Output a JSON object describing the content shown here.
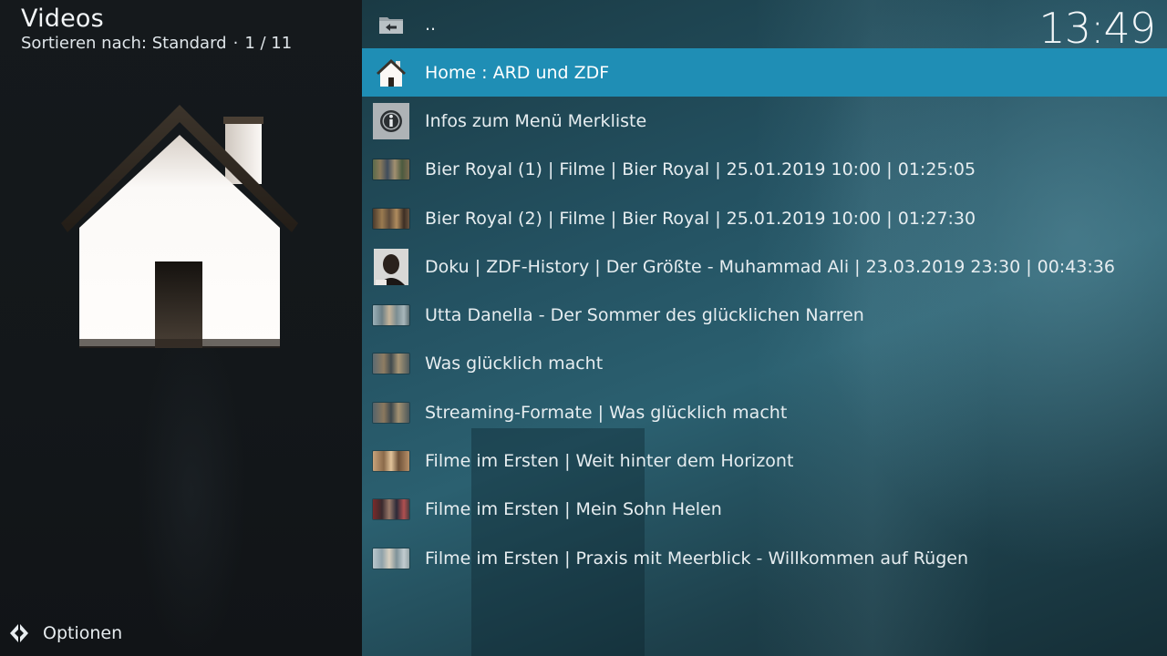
{
  "header": {
    "title": "Videos",
    "sort_label": "Sortieren nach: Standard",
    "separator": "·",
    "position": "1 / 11"
  },
  "clock": "13:49",
  "footer": {
    "options_label": "Optionen"
  },
  "list": {
    "parent_label": "..",
    "items": [
      {
        "label": "Home : ARD und ZDF",
        "icon": "home-icon",
        "focused": true
      },
      {
        "label": "Infos zum Menü Merkliste",
        "icon": "info-icon"
      },
      {
        "label": "Bier Royal (1) | Filme | Bier Royal | 25.01.2019 10:00 |  01:25:05",
        "icon": "video-thumbnail"
      },
      {
        "label": "Bier Royal (2) | Filme | Bier Royal | 25.01.2019 10:00 |  01:27:30",
        "icon": "video-thumbnail"
      },
      {
        "label": "Doku | ZDF-History | Der Größte - Muhammad Ali | 23.03.2019 23:30 |  00:43:36",
        "icon": "portrait-thumbnail"
      },
      {
        "label": "Utta Danella - Der Sommer des glücklichen Narren",
        "icon": "video-thumbnail"
      },
      {
        "label": "Was glücklich macht",
        "icon": "video-thumbnail"
      },
      {
        "label": "Streaming-Formate | Was glücklich macht",
        "icon": "video-thumbnail"
      },
      {
        "label": "Filme im Ersten | Weit hinter dem Horizont",
        "icon": "video-thumbnail"
      },
      {
        "label": "Filme im Ersten | Mein Sohn Helen",
        "icon": "video-thumbnail"
      },
      {
        "label": "Filme im Ersten | Praxis mit Meerblick - Willkommen auf Rügen",
        "icon": "video-thumbnail"
      }
    ]
  },
  "colors": {
    "focus_highlight": "#1f8eb5",
    "left_panel_bg": "#15191c",
    "text": "#e6edf0"
  }
}
